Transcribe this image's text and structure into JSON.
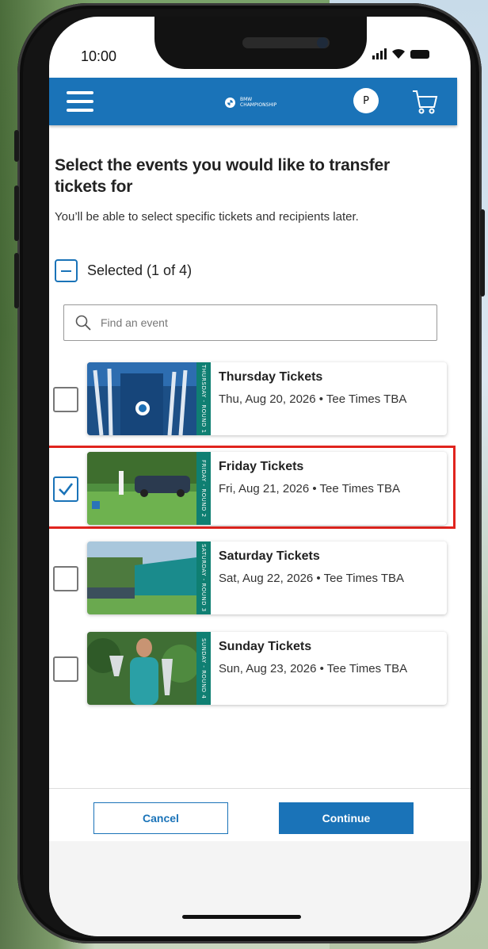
{
  "status_bar": {
    "time": "10:00"
  },
  "header": {
    "logo_line1": "BMW",
    "logo_line2": "CHAMPIONSHIP",
    "profile_initial": "P"
  },
  "page": {
    "title": "Select the events you would like to transfer tickets for",
    "subtitle": "You’ll be able to select specific tickets and recipients later.",
    "selected_label": "Selected (1 of 4)"
  },
  "search": {
    "placeholder": "Find an event"
  },
  "events": [
    {
      "title": "Thursday Tickets",
      "date": "Thu, Aug 20, 2026 • Tee Times TBA",
      "round": "THURSDAY - ROUND 1",
      "checked": false
    },
    {
      "title": "Friday Tickets",
      "date": "Fri, Aug 21, 2026 • Tee Times TBA",
      "round": "FRIDAY - ROUND 2",
      "checked": true
    },
    {
      "title": "Saturday Tickets",
      "date": "Sat, Aug 22, 2026 • Tee Times TBA",
      "round": "SATURDAY - ROUND 3",
      "checked": false
    },
    {
      "title": "Sunday Tickets",
      "date": "Sun, Aug 23, 2026 • Tee Times TBA",
      "round": "SUNDAY - ROUND 4",
      "checked": false
    }
  ],
  "footer": {
    "cancel_label": "Cancel",
    "continue_label": "Continue"
  },
  "colors": {
    "brand_blue": "#1a73b8",
    "highlight_red": "#e0241e",
    "round_teal": "#0f7f72"
  }
}
